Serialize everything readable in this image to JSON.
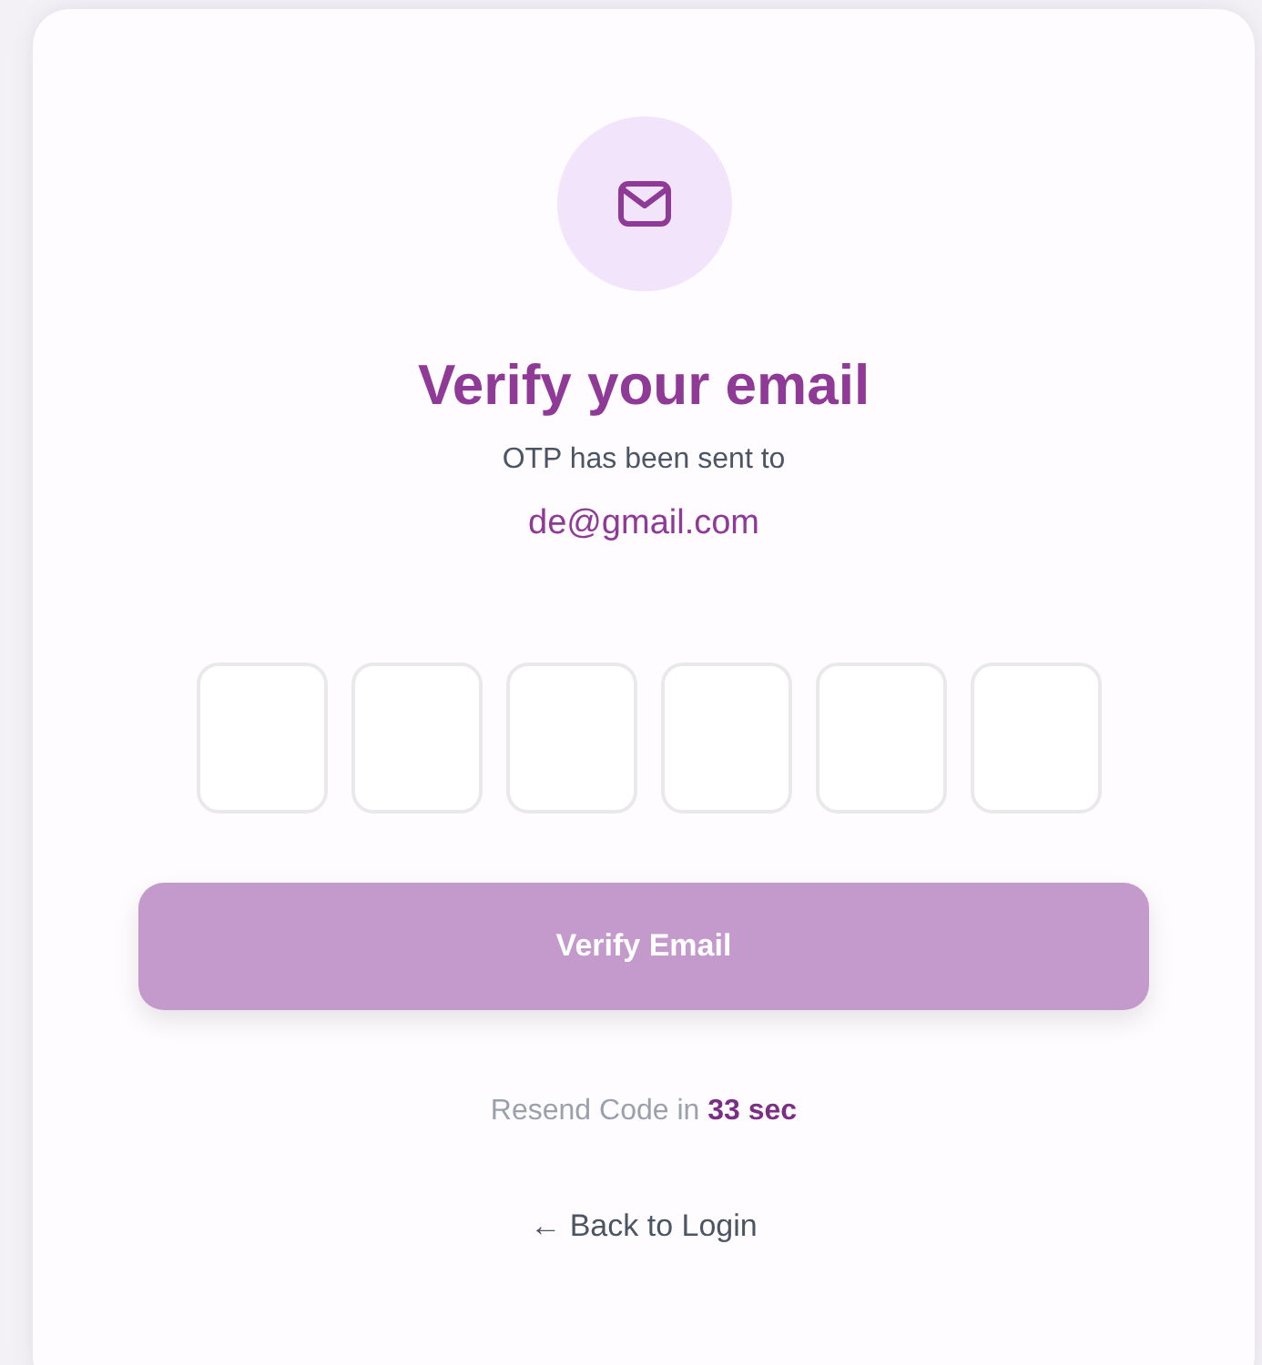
{
  "title": "Verify your email",
  "subtitle": "OTP has been sent to",
  "email": "de@gmail.com",
  "otp_fields": [
    {
      "filled": false
    },
    {
      "filled": false
    },
    {
      "filled": false
    },
    {
      "filled": false
    },
    {
      "filled": false
    },
    {
      "filled": false
    }
  ],
  "verify_button": {
    "label": "Verify Email",
    "disabled": true
  },
  "resend": {
    "label": "Resend Code in",
    "countdown": "33 sec"
  },
  "back_link": "← Back to Login"
}
